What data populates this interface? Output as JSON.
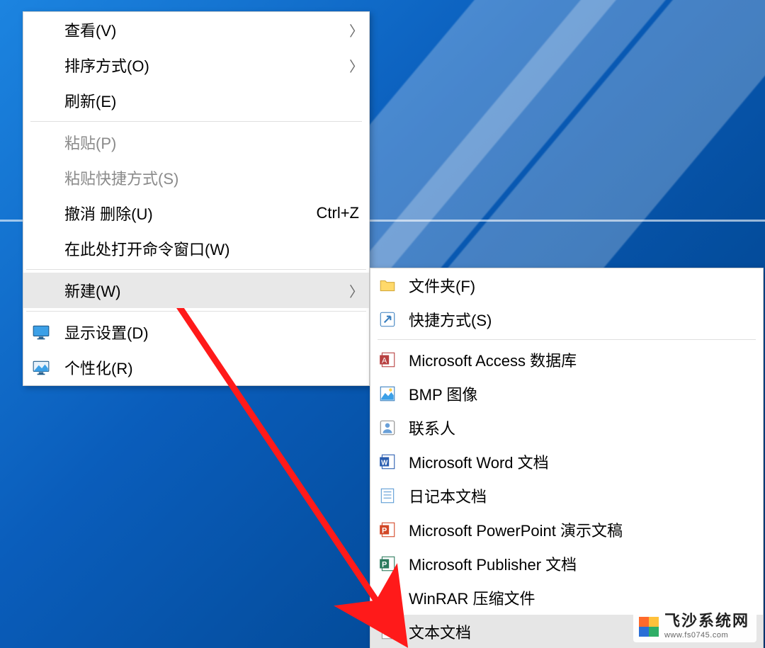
{
  "main_menu": {
    "view": {
      "label": "查看(V)",
      "has_submenu": true
    },
    "sort": {
      "label": "排序方式(O)",
      "has_submenu": true
    },
    "refresh": {
      "label": "刷新(E)"
    },
    "paste": {
      "label": "粘贴(P)",
      "disabled": true
    },
    "paste_shortcut": {
      "label": "粘贴快捷方式(S)",
      "disabled": true
    },
    "undo_delete": {
      "label": "撤消 删除(U)",
      "shortcut": "Ctrl+Z"
    },
    "open_cmd": {
      "label": "在此处打开命令窗口(W)"
    },
    "new": {
      "label": "新建(W)",
      "has_submenu": true,
      "highlighted": true
    },
    "display": {
      "label": "显示设置(D)",
      "icon": "display-settings-icon"
    },
    "personalize": {
      "label": "个性化(R)",
      "icon": "personalize-icon"
    }
  },
  "sub_menu": {
    "folder": {
      "label": "文件夹(F)",
      "icon": "folder-icon"
    },
    "shortcut": {
      "label": "快捷方式(S)",
      "icon": "shortcut-icon"
    },
    "access": {
      "label": "Microsoft Access 数据库",
      "icon": "access-icon"
    },
    "bmp": {
      "label": "BMP 图像",
      "icon": "bmp-icon"
    },
    "contact": {
      "label": "联系人",
      "icon": "contact-icon"
    },
    "word": {
      "label": "Microsoft Word 文档",
      "icon": "word-icon"
    },
    "journal": {
      "label": "日记本文档",
      "icon": "journal-icon"
    },
    "powerpoint": {
      "label": "Microsoft PowerPoint 演示文稿",
      "icon": "powerpoint-icon"
    },
    "publisher": {
      "label": "Microsoft Publisher 文档",
      "icon": "publisher-icon"
    },
    "winrar": {
      "label": "WinRAR 压缩文件",
      "icon": "winrar-icon"
    },
    "text": {
      "label": "文本文档",
      "icon": "text-icon",
      "highlighted": true
    }
  },
  "watermark": {
    "title": "飞沙系统网",
    "url": "www.fs0745.com"
  }
}
